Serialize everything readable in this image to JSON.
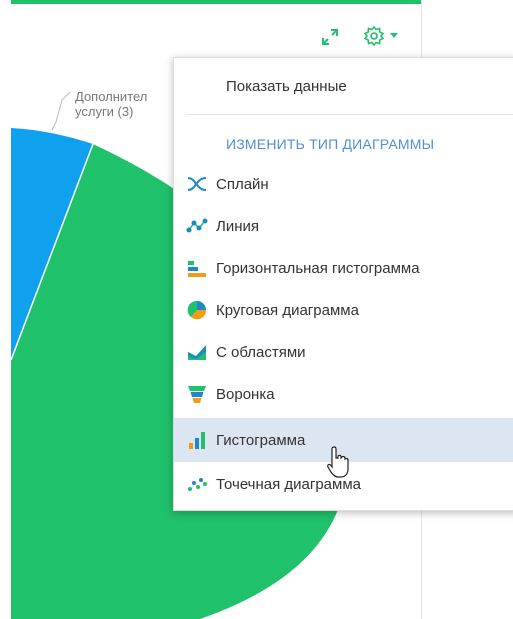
{
  "pie": {
    "label_line1": "Дополнител",
    "label_line2": "услуги (3)",
    "colors": {
      "green": "#1fc16b",
      "blue": "#0fa1ee"
    }
  },
  "toolbar": {
    "expand_icon": "expand-icon",
    "settings_icon": "gear-icon",
    "dropdown_icon": "caret-down-icon",
    "accent": "#1fc16b"
  },
  "menu": {
    "show_data": "Показать данные",
    "section_title": "ИЗМЕНИТЬ ТИП ДИАГРАММЫ",
    "items": [
      {
        "label": "Сплайн",
        "icon": "spline-icon"
      },
      {
        "label": "Линия",
        "icon": "line-chart-icon"
      },
      {
        "label": "Горизонтальная гистограмма",
        "icon": "horizontal-bar-icon"
      },
      {
        "label": "Круговая диаграмма",
        "icon": "pie-chart-icon"
      },
      {
        "label": "С областями",
        "icon": "area-chart-icon"
      },
      {
        "label": "Воронка",
        "icon": "funnel-icon"
      },
      {
        "label": "Гистограмма",
        "icon": "bar-chart-icon"
      },
      {
        "label": "Точечная диаграмма",
        "icon": "scatter-icon"
      }
    ]
  }
}
